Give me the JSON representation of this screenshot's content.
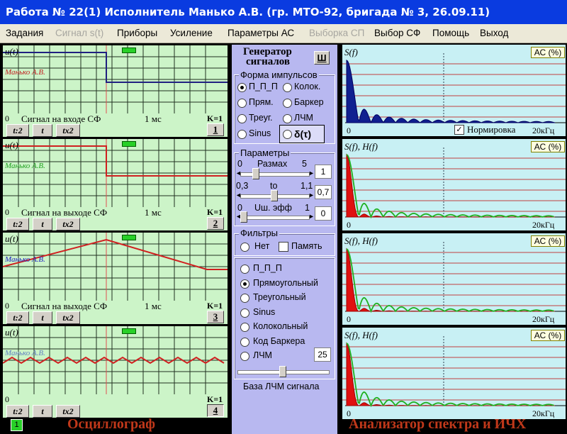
{
  "window": {
    "title": "Работа № 22(1)  Исполнитель Манько А.В. (гр. МТО-92, бригада № 3, 26.09.11)"
  },
  "menu": [
    {
      "label": "Задания",
      "disabled": false
    },
    {
      "label": "Сигнал s(t)",
      "disabled": true
    },
    {
      "label": "Приборы",
      "disabled": false
    },
    {
      "label": "Усиление",
      "disabled": false
    },
    {
      "label": "Параметры  АС",
      "disabled": false
    },
    {
      "label": "Выборка СП",
      "disabled": true
    },
    {
      "label": "Выбор СФ",
      "disabled": false
    },
    {
      "label": "Помощь",
      "disabled": false
    },
    {
      "label": "Выход",
      "disabled": false
    }
  ],
  "scopes": [
    {
      "ylabel": "u(t)",
      "watermark": "Манько А.В.",
      "wm_color": "#c02020",
      "zero": "0",
      "caption": "Сигнал на входе СФ",
      "time": "1 мс",
      "k": "K=1",
      "num": "1",
      "pressed": false,
      "wave_color": "#202080",
      "wave": "step"
    },
    {
      "ylabel": "u(t)",
      "watermark": "Манько А.В.",
      "wm_color": "#20a020",
      "zero": "0",
      "caption": "Сигнал на выходе СФ",
      "time": "1 мс",
      "k": "K=1",
      "num": "2",
      "pressed": false,
      "wave_color": "#d02020",
      "wave": "step"
    },
    {
      "ylabel": "u(t)",
      "watermark": "Манько А.В.",
      "wm_color": "#2020c0",
      "zero": "0",
      "caption": "Сигнал на выходе СФ",
      "time": "1 мс",
      "k": "K=1",
      "num": "3",
      "pressed": false,
      "wave_color": "#d02020",
      "wave": "triangle"
    },
    {
      "ylabel": "u(t)",
      "watermark": "Манько А.В.",
      "wm_color": "#6080c0",
      "zero": "0",
      "caption": "",
      "time": "",
      "k": "K=1",
      "num": "4",
      "pressed": true,
      "wave_color": "#d02020",
      "wave": "zigzag"
    }
  ],
  "scope_buttons": {
    "t2": "t:2",
    "t": "t",
    "tx2": "tx2"
  },
  "oscilloscope": {
    "label": "Осциллограф",
    "indicator": "1"
  },
  "generator": {
    "title1": "Генератор",
    "title2": "сигналов",
    "sh_button": "Ш",
    "pulse_group": "Форма  импульсов",
    "pulse_options": [
      {
        "label": "П_П_П",
        "selected": true
      },
      {
        "label": "Колок.",
        "selected": false
      },
      {
        "label": "Прям.",
        "selected": false
      },
      {
        "label": "Баркер",
        "selected": false
      },
      {
        "label": "Треуг.",
        "selected": false
      },
      {
        "label": "ЛЧМ",
        "selected": false
      },
      {
        "label": "Sinus",
        "selected": false
      },
      {
        "label": "δ(τ)",
        "selected": false
      }
    ],
    "params_group": "Параметры",
    "param1": {
      "min": "0",
      "label": "Размах",
      "max": "5",
      "value": "1",
      "fraction": 0.2
    },
    "param2": {
      "min": "0,3",
      "label": "to",
      "max": "1,1",
      "value": "0,7",
      "fraction": 0.5
    },
    "param3": {
      "min": "0",
      "label": "Uш. эфф",
      "max": "1",
      "value": "0",
      "fraction": 0.0
    },
    "filters_group": "Фильтры",
    "filter_none": "Нет",
    "filter_mem": "Память",
    "filter_options": [
      {
        "label": "П_П_П",
        "selected": false
      },
      {
        "label": "Прямоугольный",
        "selected": true
      },
      {
        "label": "Треугольный",
        "selected": false
      },
      {
        "label": "Sinus",
        "selected": false
      },
      {
        "label": "Колокольный",
        "selected": false
      },
      {
        "label": "Код Баркера",
        "selected": false
      },
      {
        "label": "ЛЧМ",
        "selected": false
      }
    ],
    "lfm_value": "25",
    "lfm_base_label": "База ЛЧМ сигнала",
    "lfm_fraction": 0.5
  },
  "spectrum": [
    {
      "label": "S(f)",
      "ac": "АС (%)",
      "zero": "0",
      "freq": "20кГц",
      "mode": "input",
      "normalize": "Нормировка"
    },
    {
      "label": "S(f), H(f)",
      "ac": "АС (%)",
      "zero": "0",
      "freq": "20кГц",
      "mode": "output"
    },
    {
      "label": "S(f), H(f)",
      "ac": "АС (%)",
      "zero": "0",
      "freq": "20кГц",
      "mode": "output"
    },
    {
      "label": "S(f), H(f)",
      "ac": "АС (%)",
      "zero": "0",
      "freq": "20кГц",
      "mode": "output"
    }
  ],
  "spectrum_analyzer": {
    "label": "Анализатор спектра и ИЧХ"
  },
  "colors": {
    "scope_bg": "#ccf4c8",
    "spectrum_bg": "#c8f0f4",
    "center_bg": "#b8b8f0",
    "title_bg": "#0a3be0"
  }
}
